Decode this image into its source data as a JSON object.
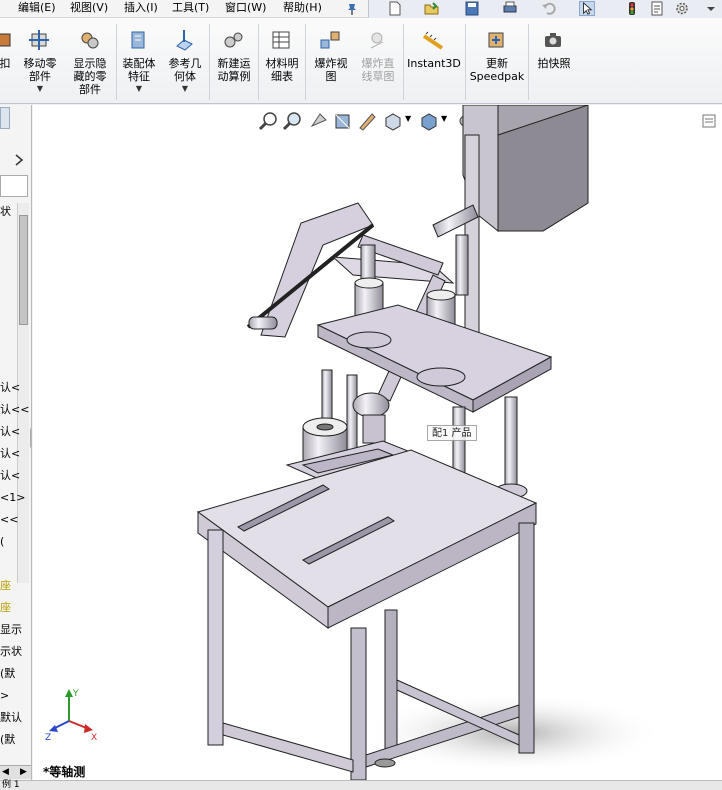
{
  "menu": {
    "items": [
      "编辑(E)",
      "视图(V)",
      "插入(I)",
      "工具(T)",
      "窗口(W)",
      "帮助(H)"
    ]
  },
  "ribbon": {
    "partial_left_label": "扣",
    "buttons": [
      {
        "label1": "移动零",
        "label2": "部件",
        "label3": "",
        "dropdown": true,
        "disabled": false
      },
      {
        "label1": "显示隐",
        "label2": "藏的零",
        "label3": "部件",
        "dropdown": false,
        "disabled": false
      },
      {
        "label1": "装配体",
        "label2": "特征",
        "label3": "",
        "dropdown": true,
        "disabled": false
      },
      {
        "label1": "参考几",
        "label2": "何体",
        "label3": "",
        "dropdown": true,
        "disabled": false
      },
      {
        "label1": "新建运",
        "label2": "动算例",
        "label3": "",
        "dropdown": false,
        "disabled": false
      },
      {
        "label1": "材料明",
        "label2": "细表",
        "label3": "",
        "dropdown": false,
        "disabled": false
      },
      {
        "label1": "爆炸视",
        "label2": "图",
        "label3": "",
        "dropdown": false,
        "disabled": false
      },
      {
        "label1": "爆炸直",
        "label2": "线草图",
        "label3": "",
        "dropdown": false,
        "disabled": true
      },
      {
        "label1": "Instant3D",
        "label2": "",
        "label3": "",
        "dropdown": false,
        "disabled": false
      },
      {
        "label1": "更新",
        "label2": "Speedpak",
        "label3": "",
        "dropdown": false,
        "disabled": false
      },
      {
        "label1": "拍快照",
        "label2": "",
        "label3": "",
        "dropdown": false,
        "disabled": false
      }
    ]
  },
  "tree_fragments": [
    "状",
    "认<",
    "认<<",
    "认<",
    "认<",
    "认<",
    "<1>",
    "<<",
    "(",
    "座",
    "座",
    "显示",
    "示状",
    "(默",
    ">",
    "默认",
    "(默"
  ],
  "viewport": {
    "tooltip": "配1 产品",
    "view_label": "*等轴测",
    "triad": {
      "x": "X",
      "y": "Y",
      "z": "Z"
    }
  },
  "status": {
    "text": "例 1"
  },
  "colors": {
    "part": "#d8d2e0",
    "edge": "#222222",
    "ribbon_icon_blue": "#2e64a8",
    "tree_yellow": "#b8a000"
  }
}
